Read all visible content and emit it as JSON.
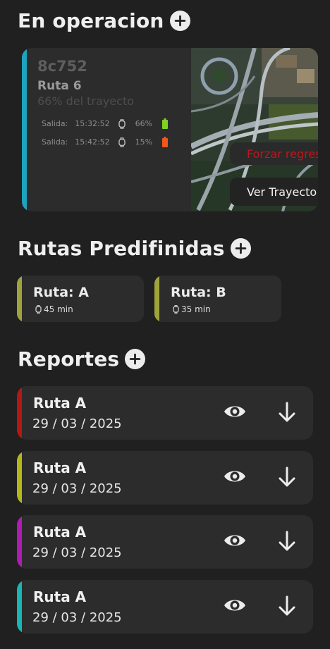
{
  "in_operation": {
    "title": "En operacion",
    "card": {
      "code": "8c752",
      "route": "Ruta 6",
      "progress": "66% del trayecto",
      "accent_color": "#1ea3bf",
      "departures": [
        {
          "label": "Salida:",
          "time": "15:32:52",
          "icon": "smartwatch-icon",
          "battery_pct": "66%",
          "battery_color": "#7ed321"
        },
        {
          "label": "Salida:",
          "time": "15:42:52",
          "icon": "smartwatch-icon",
          "battery_pct": "15%",
          "battery_color": "#f2561d"
        }
      ],
      "force_button": "Forzar regreso",
      "view_button": "Ver Trayecto"
    }
  },
  "predefined_routes": {
    "title": "Rutas Predifinidas",
    "accent_color": "#9ea43a",
    "items": [
      {
        "label": "Ruta: A",
        "duration": "45 min"
      },
      {
        "label": "Ruta: B",
        "duration": "35 min"
      }
    ]
  },
  "reports": {
    "title": "Reportes",
    "items": [
      {
        "route": "Ruta A",
        "date": "29 / 03 / 2025",
        "accent_color": "#b51717"
      },
      {
        "route": "Ruta A",
        "date": "29 / 03 / 2025",
        "accent_color": "#b5b71b"
      },
      {
        "route": "Ruta A",
        "date": "29 / 03 / 2025",
        "accent_color": "#b01ab5"
      },
      {
        "route": "Ruta A",
        "date": "29 / 03 / 2025",
        "accent_color": "#1ab5b5"
      }
    ]
  }
}
